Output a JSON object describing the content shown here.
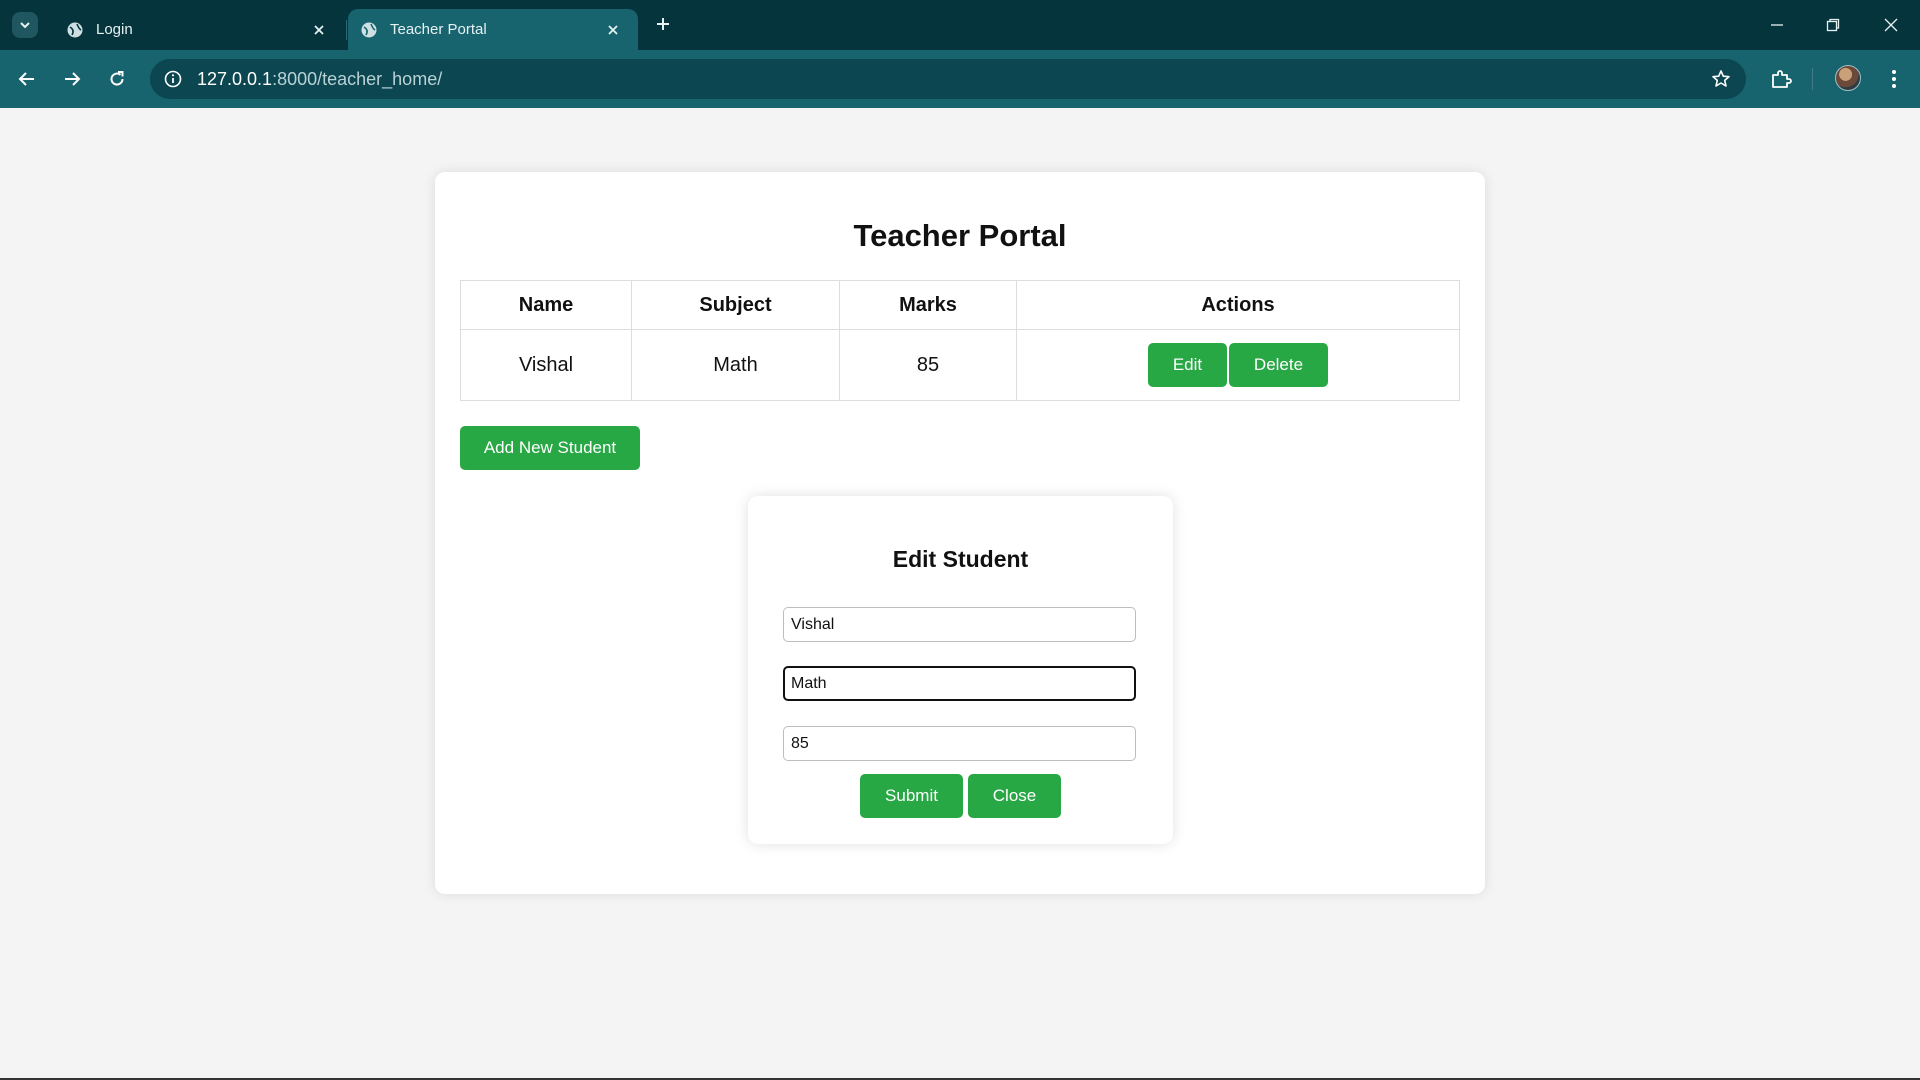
{
  "browser": {
    "tabs": [
      {
        "label": "Login",
        "active": false
      },
      {
        "label": "Teacher Portal",
        "active": true
      }
    ],
    "url_host": "127.0.0.1",
    "url_path": ":8000/teacher_home/"
  },
  "page": {
    "title": "Teacher Portal",
    "table": {
      "headers": [
        "Name",
        "Subject",
        "Marks",
        "Actions"
      ],
      "rows": [
        {
          "name": "Vishal",
          "subject": "Math",
          "marks": "85"
        }
      ],
      "edit_label": "Edit",
      "delete_label": "Delete"
    },
    "add_button": "Add New Student"
  },
  "modal": {
    "title": "Edit Student",
    "name_value": "Vishal",
    "subject_value": "Math",
    "marks_value": "85",
    "submit_label": "Submit",
    "close_label": "Close"
  },
  "colors": {
    "accent_green": "#28a745",
    "tabstrip": "#06343d",
    "toolbar": "#17636e"
  }
}
